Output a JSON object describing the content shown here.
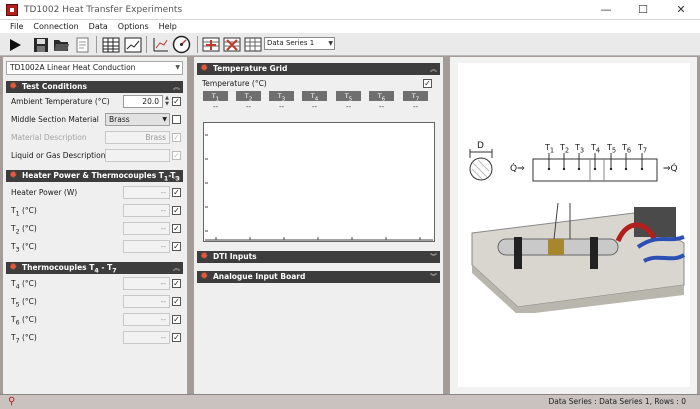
{
  "window": {
    "title": "TD1002 Heat Transfer Experiments",
    "minimize": "—",
    "maximize": "☐",
    "close": "✕"
  },
  "menu": [
    "File",
    "Connection",
    "Data",
    "Options",
    "Help"
  ],
  "toolbar": {
    "series_select": "Data Series 1"
  },
  "sample": {
    "selected": "TD1002A Linear Heat Conduction"
  },
  "test_conditions": {
    "title": "Test Conditions",
    "ambient_label": "Ambient Temperature (°C)",
    "ambient_value": "20.0",
    "middle_label": "Middle Section Material",
    "middle_value": "Brass",
    "material_desc_label": "Material Description",
    "material_desc_value": "Brass",
    "liquid_label": "Liquid or Gas Description"
  },
  "heater": {
    "title": "Heater Power & Thermocouples T",
    "title_sub1": "1",
    "title_dash": "-T",
    "title_sub2": "3",
    "rows": [
      {
        "label": "Heater Power  (W)",
        "value": "--"
      },
      {
        "label": "T",
        "sub": "1",
        "unit": " (°C)",
        "value": "--"
      },
      {
        "label": "T",
        "sub": "2",
        "unit": " (°C)",
        "value": "--"
      },
      {
        "label": "T",
        "sub": "3",
        "unit": " (°C)",
        "value": "--"
      }
    ]
  },
  "thermo": {
    "title": "Thermocouples T",
    "title_sub1": "4",
    "title_dash": " - T",
    "title_sub2": "7",
    "rows": [
      {
        "label": "T",
        "sub": "4",
        "unit": " (°C)",
        "value": "--"
      },
      {
        "label": "T",
        "sub": "5",
        "unit": " (°C)",
        "value": "--"
      },
      {
        "label": "T",
        "sub": "6",
        "unit": " (°C)",
        "value": "--"
      },
      {
        "label": "T",
        "sub": "7",
        "unit": " (°C)",
        "value": "--"
      }
    ]
  },
  "grid": {
    "title": "Temperature Grid",
    "temp_label": "Temperature (°C)",
    "columns": [
      {
        "t": "T",
        "sub": "1",
        "value": "--"
      },
      {
        "t": "T",
        "sub": "2",
        "value": "--"
      },
      {
        "t": "T",
        "sub": "3",
        "value": "--"
      },
      {
        "t": "T",
        "sub": "4",
        "value": "--"
      },
      {
        "t": "T",
        "sub": "5",
        "value": "--"
      },
      {
        "t": "T",
        "sub": "6",
        "value": "--"
      },
      {
        "t": "T",
        "sub": "7",
        "value": "--"
      }
    ]
  },
  "dti": {
    "title": "DTI Inputs"
  },
  "analogue": {
    "title": "Analogue Input Board"
  },
  "diagram": {
    "d_label": "D",
    "q_left": "Q̇⇒",
    "q_right": "⇒Q̇",
    "t_labels": [
      "T1",
      "T2",
      "T3",
      "T4",
      "T5",
      "T6",
      "T7"
    ],
    "tsub": [
      "1",
      "2",
      "3",
      "4",
      "5",
      "6",
      "7"
    ]
  },
  "status": {
    "text": "Data Series : Data Series 1,  Rows : 0"
  },
  "colors": {
    "accent": "#e35a3a",
    "header": "#3d3d3d",
    "frame": "#a39c98"
  }
}
